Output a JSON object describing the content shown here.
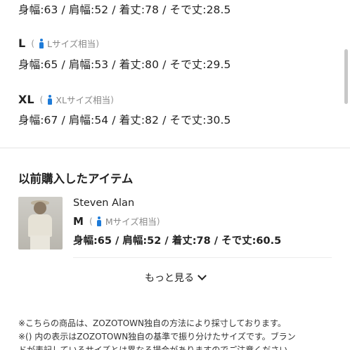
{
  "sizes": [
    {
      "label": "",
      "note": "",
      "measurements": "身幅:63 / 肩幅:52 / 着丈:78 / そで丈:28.5"
    },
    {
      "label": "L",
      "note": "Lサイズ相当",
      "measurements": "身幅:65 / 肩幅:53 / 着丈:80 / そで丈:29.5"
    },
    {
      "label": "XL",
      "note": "XLサイズ相当",
      "measurements": "身幅:67 / 肩幅:54 / 着丈:82 / そで丈:30.5"
    }
  ],
  "paren_open": "(",
  "paren_close": ")",
  "previous": {
    "title": "以前購入したアイテム",
    "brand": "Steven Alan",
    "size_label": "M",
    "size_note": "Mサイズ相当",
    "measurements": "身幅:65 / 肩幅:52 / 着丈:78 / そで丈:60.5",
    "photo_icon": "product-photo-person"
  },
  "more_label": "もっと見る",
  "notes": [
    "※こちらの商品は、ZOZOTOWN独自の方法により採寸しております。",
    "※() 内の表示はZOZOTOWN独自の基準で振り分けたサイズです。ブラン",
    "ドが表記しているサイズとは異なる場合がありますのでご注意ください。"
  ],
  "colors": {
    "accent_icon": "#1e7bd8",
    "text": "#222222",
    "muted": "#888888"
  }
}
